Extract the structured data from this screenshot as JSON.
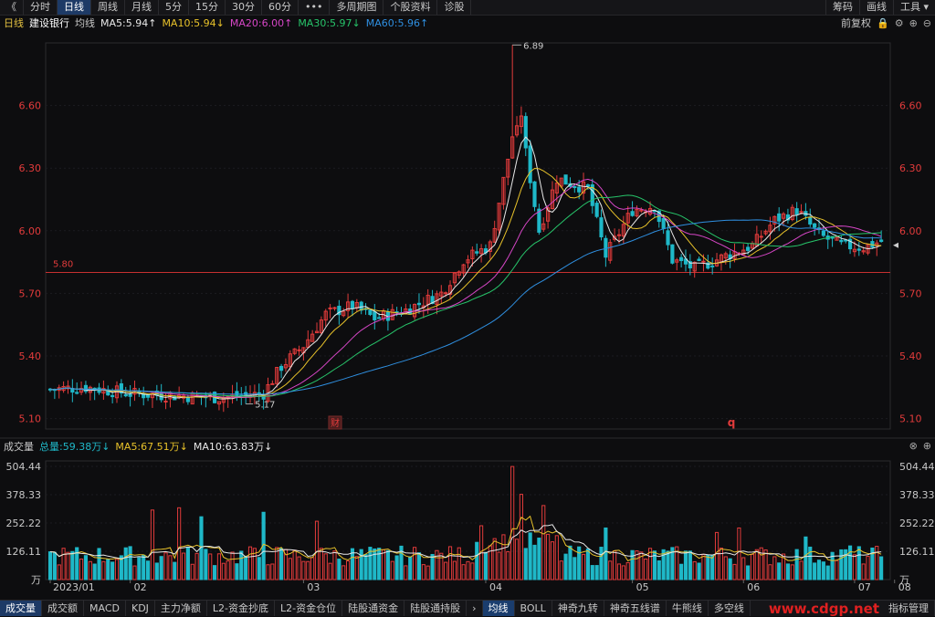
{
  "toolbar": {
    "back": "《",
    "items": [
      "分时",
      "日线",
      "周线",
      "月线",
      "5分",
      "15分",
      "30分",
      "60分",
      "•••",
      "多周期图",
      "个股资料",
      "诊股"
    ],
    "active_index": 1,
    "right_items": [
      "筹码",
      "画线",
      "工具 ▾"
    ]
  },
  "info": {
    "period": "日线",
    "stock": "建设银行",
    "ma_label": "均线",
    "ma5": "MA5:5.94↑",
    "ma10": "MA10:5.94↓",
    "ma20": "MA20:6.00↑",
    "ma30": "MA30:5.97↓",
    "ma60": "MA60:5.96↑",
    "adjust": "前复权"
  },
  "vol_info": {
    "label": "成交量",
    "total": "总量:59.38万↓",
    "ma5": "MA5:67.51万↓",
    "ma10": "MA10:63.83万↓"
  },
  "bottom_tabs": [
    "成交量",
    "成交额",
    "MACD",
    "KDJ",
    "主力净额",
    "L2-资金抄底",
    "L2-资金仓位",
    "陆股通资金",
    "陆股通持股"
  ],
  "bottom_tabs2": [
    "均线",
    "BOLL",
    "神奇九转",
    "神奇五线谱",
    "牛熊线",
    "多空线"
  ],
  "bottom_right": "指标管理",
  "watermark": "www.cdgp.net",
  "colors": {
    "up": "#e23b3b",
    "down": "#1fb8c8",
    "ma5": "#e8e8e8",
    "ma10": "#e8c22a",
    "ma20": "#d646c6",
    "ma30": "#27c46a",
    "ma60": "#2f8fe0"
  },
  "chart_data": [
    {
      "type": "candlestick",
      "y_ticks": [
        "6.60",
        "6.30",
        "6.00",
        "5.70",
        "5.40",
        "5.10"
      ],
      "ylim": [
        5.05,
        6.9
      ],
      "x_ticks": [
        "2023/01",
        "02",
        "03",
        "04",
        "05",
        "06",
        "07",
        "08"
      ],
      "high_marker": "6.89",
      "low_marker": "5.17",
      "support_line": {
        "value": 5.8,
        "label": "5.80"
      },
      "event_markers": [
        "财",
        "q"
      ],
      "n_days": 152,
      "anchors": [
        [
          0,
          5.24
        ],
        [
          8,
          5.25
        ],
        [
          18,
          5.22
        ],
        [
          28,
          5.21
        ],
        [
          38,
          5.2
        ],
        [
          43,
          5.21
        ],
        [
          48,
          5.22
        ],
        [
          52,
          5.35
        ],
        [
          57,
          5.45
        ],
        [
          62,
          5.6
        ],
        [
          68,
          5.64
        ],
        [
          73,
          5.58
        ],
        [
          80,
          5.62
        ],
        [
          88,
          5.7
        ],
        [
          93,
          5.86
        ],
        [
          99,
          5.93
        ],
        [
          104,
          6.45
        ],
        [
          106,
          6.5
        ],
        [
          110,
          6.0
        ],
        [
          114,
          6.25
        ],
        [
          121,
          6.2
        ],
        [
          125,
          5.88
        ],
        [
          131,
          6.1
        ],
        [
          136,
          6.12
        ],
        [
          140,
          5.86
        ],
        [
          145,
          5.82
        ],
        [
          151,
          5.87
        ],
        [
          152,
          5.88
        ],
        [
          158,
          5.93
        ],
        [
          163,
          6.05
        ],
        [
          168,
          6.1
        ],
        [
          173,
          5.98
        ],
        [
          178,
          5.93
        ],
        [
          183,
          5.92
        ],
        [
          187,
          5.95
        ]
      ]
    },
    {
      "type": "bar",
      "y_ticks": [
        "504.44",
        "378.33",
        "252.22",
        "126.11",
        "万"
      ],
      "ylim": [
        0,
        504.44
      ],
      "peak_values": [
        [
          23,
          310
        ],
        [
          29,
          320
        ],
        [
          34,
          280
        ],
        [
          48,
          300
        ],
        [
          60,
          260
        ],
        [
          97,
          240
        ],
        [
          104,
          504
        ],
        [
          106,
          380
        ],
        [
          111,
          330
        ],
        [
          125,
          230
        ],
        [
          150,
          210
        ],
        [
          155,
          230
        ],
        [
          170,
          190
        ],
        [
          180,
          150
        ]
      ]
    }
  ]
}
